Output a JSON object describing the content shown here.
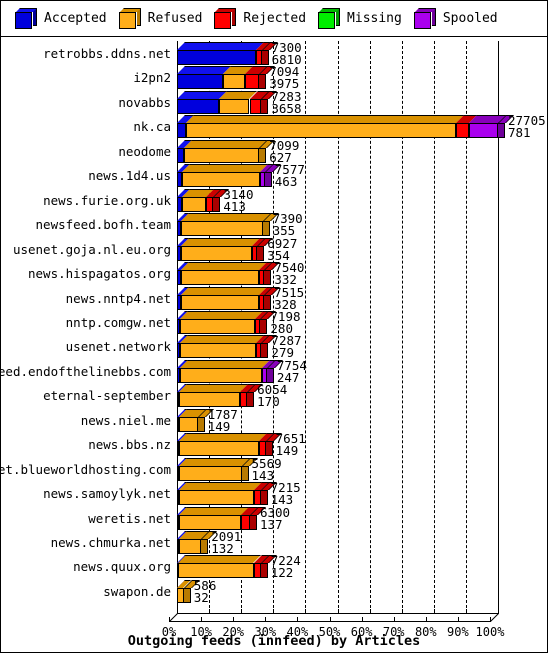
{
  "legend": {
    "items": [
      {
        "label": "Accepted",
        "color": "#0000DD",
        "top": "#1111EE",
        "side": "#000099",
        "icon": "cube-icon"
      },
      {
        "label": "Refused",
        "color": "#FFAE1A",
        "top": "#D99100",
        "side": "#B87A00",
        "icon": "cube-icon"
      },
      {
        "label": "Rejected",
        "color": "#FF0000",
        "top": "#CC0000",
        "side": "#AA0000",
        "icon": "cube-icon"
      },
      {
        "label": "Missing",
        "color": "#00EE00",
        "top": "#00BB00",
        "side": "#009900",
        "icon": "cube-icon"
      },
      {
        "label": "Spooled",
        "color": "#AA00EE",
        "top": "#8800BB",
        "side": "#6E0099",
        "icon": "cube-icon"
      }
    ]
  },
  "chart_data": {
    "type": "bar",
    "orientation": "horizontal",
    "stacked": true,
    "title": "Outgoing feeds (innfeed) by Articles",
    "xlabel": "",
    "ylabel": "",
    "xlim": [
      0,
      100
    ],
    "xunit": "%",
    "grid": true,
    "xticks": [
      "0%",
      "10%",
      "20%",
      "30%",
      "40%",
      "50%",
      "60%",
      "70%",
      "80%",
      "90%",
      "100%"
    ],
    "xtick_values": [
      0,
      10,
      20,
      30,
      40,
      50,
      60,
      70,
      80,
      90,
      100
    ],
    "legend_position": "top",
    "series_names": [
      "Accepted",
      "Refused",
      "Rejected",
      "Missing",
      "Spooled"
    ],
    "series_colors": [
      "#0000DD",
      "#FFAE1A",
      "#FF0000",
      "#00EE00",
      "#AA00EE"
    ],
    "max_total": 27705,
    "categories": [
      "retrobbs.ddns.net",
      "i2pn2",
      "novabbs",
      "nk.ca",
      "neodome",
      "news.1d4.us",
      "news.furie.org.uk",
      "newsfeed.bofh.team",
      "usenet.goja.nl.eu.org",
      "news.hispagatos.org",
      "news.nntp4.net",
      "nntp.comgw.net",
      "usenet.network",
      "newsfeed.endofthelinebbs.com",
      "eternal-september",
      "news.niel.me",
      "news.bbs.nz",
      "usenet.blueworldhosting.com",
      "news.samoylyk.net",
      "weretis.net",
      "news.chmurka.net",
      "news.quux.org",
      "swapon.de"
    ],
    "rows": [
      {
        "category": "retrobbs.ddns.net",
        "total": 7300,
        "accepted_label": "6810",
        "accepted": 6810,
        "refused": 0,
        "rejected": 490,
        "missing": 0,
        "spooled": 0
      },
      {
        "category": "i2pn2",
        "total": 7094,
        "accepted_label": "3975",
        "accepted": 3975,
        "refused": 1900,
        "rejected": 1219,
        "missing": 0,
        "spooled": 0
      },
      {
        "category": "novabbs",
        "total": 7283,
        "accepted_label": "3658",
        "accepted": 3658,
        "refused": 2600,
        "rejected": 1025,
        "missing": 0,
        "spooled": 0
      },
      {
        "category": "nk.ca",
        "total": 27705,
        "accepted_label": "781",
        "accepted": 781,
        "refused": 23300,
        "rejected": 1100,
        "missing": 0,
        "spooled": 2524
      },
      {
        "category": "neodome",
        "total": 7099,
        "accepted_label": "627",
        "accepted": 627,
        "refused": 6472,
        "rejected": 0,
        "missing": 0,
        "spooled": 0
      },
      {
        "category": "news.1d4.us",
        "total": 7577,
        "accepted_label": "463",
        "accepted": 463,
        "refused": 6714,
        "rejected": 0,
        "missing": 0,
        "spooled": 400
      },
      {
        "category": "news.furie.org.uk",
        "total": 3140,
        "accepted_label": "413",
        "accepted": 413,
        "refused": 2100,
        "rejected": 627,
        "missing": 0,
        "spooled": 0
      },
      {
        "category": "newsfeed.bofh.team",
        "total": 7390,
        "accepted_label": "355",
        "accepted": 355,
        "refused": 7035,
        "rejected": 0,
        "missing": 0,
        "spooled": 0
      },
      {
        "category": "usenet.goja.nl.eu.org",
        "total": 6927,
        "accepted_label": "354",
        "accepted": 354,
        "refused": 6130,
        "rejected": 443,
        "missing": 0,
        "spooled": 0
      },
      {
        "category": "news.hispagatos.org",
        "total": 7540,
        "accepted_label": "332",
        "accepted": 332,
        "refused": 6750,
        "rejected": 458,
        "missing": 0,
        "spooled": 0
      },
      {
        "category": "news.nntp4.net",
        "total": 7515,
        "accepted_label": "328",
        "accepted": 328,
        "refused": 6740,
        "rejected": 447,
        "missing": 0,
        "spooled": 0
      },
      {
        "category": "nntp.comgw.net",
        "total": 7198,
        "accepted_label": "280",
        "accepted": 280,
        "refused": 6470,
        "rejected": 448,
        "missing": 0,
        "spooled": 0
      },
      {
        "category": "usenet.network",
        "total": 7287,
        "accepted_label": "279",
        "accepted": 279,
        "refused": 6560,
        "rejected": 448,
        "missing": 0,
        "spooled": 0
      },
      {
        "category": "newsfeed.endofthelinebbs.com",
        "total": 7754,
        "accepted_label": "247",
        "accepted": 247,
        "refused": 7050,
        "rejected": 0,
        "missing": 0,
        "spooled": 457
      },
      {
        "category": "eternal-september",
        "total": 6054,
        "accepted_label": "170",
        "accepted": 170,
        "refused": 5300,
        "rejected": 584,
        "missing": 0,
        "spooled": 0
      },
      {
        "category": "news.niel.me",
        "total": 1787,
        "accepted_label": "149",
        "accepted": 149,
        "refused": 1638,
        "rejected": 0,
        "missing": 0,
        "spooled": 0
      },
      {
        "category": "news.bbs.nz",
        "total": 7651,
        "accepted_label": "149",
        "accepted": 149,
        "refused": 6930,
        "rejected": 572,
        "missing": 0,
        "spooled": 0
      },
      {
        "category": "usenet.blueworldhosting.com",
        "total": 5569,
        "accepted_label": "143",
        "accepted": 143,
        "refused": 5426,
        "rejected": 0,
        "missing": 0,
        "spooled": 0
      },
      {
        "category": "news.samoylyk.net",
        "total": 7215,
        "accepted_label": "143",
        "accepted": 143,
        "refused": 6500,
        "rejected": 572,
        "missing": 0,
        "spooled": 0
      },
      {
        "category": "weretis.net",
        "total": 6300,
        "accepted_label": "137",
        "accepted": 137,
        "refused": 5400,
        "rejected": 763,
        "missing": 0,
        "spooled": 0
      },
      {
        "category": "news.chmurka.net",
        "total": 2091,
        "accepted_label": "132",
        "accepted": 132,
        "refused": 1959,
        "rejected": 0,
        "missing": 0,
        "spooled": 0
      },
      {
        "category": "news.quux.org",
        "total": 7224,
        "accepted_label": "122",
        "accepted": 122,
        "refused": 6500,
        "rejected": 602,
        "missing": 0,
        "spooled": 0
      },
      {
        "category": "swapon.de",
        "total": 586,
        "accepted_label": "32",
        "accepted": 32,
        "refused": 554,
        "rejected": 0,
        "missing": 0,
        "spooled": 0
      }
    ]
  }
}
